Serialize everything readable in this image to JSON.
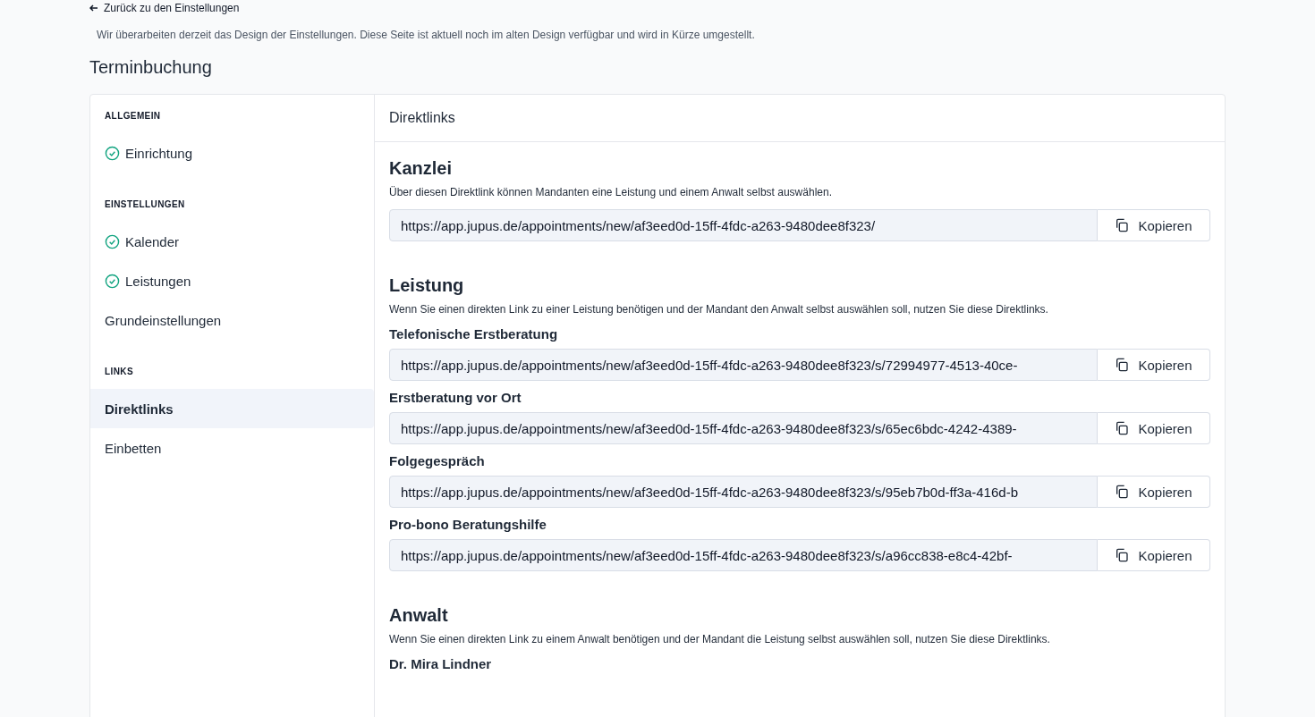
{
  "back_link": {
    "label": "Zurück zu den Einstellungen"
  },
  "notice": "Wir überarbeiten derzeit das Design der Einstellungen. Diese Seite ist aktuell noch im alten Design verfügbar und wird in Kürze umgestellt.",
  "page_title": "Terminbuchung",
  "sidebar": {
    "groups": [
      {
        "heading": "ALLGEMEIN",
        "items": [
          {
            "label": "Einrichtung",
            "done": true,
            "selected": false
          }
        ]
      },
      {
        "heading": "EINSTELLUNGEN",
        "items": [
          {
            "label": "Kalender",
            "done": true,
            "selected": false
          },
          {
            "label": "Leistungen",
            "done": true,
            "selected": false
          },
          {
            "label": "Grundeinstellungen",
            "done": false,
            "selected": false
          }
        ]
      },
      {
        "heading": "LINKS",
        "items": [
          {
            "label": "Direktlinks",
            "done": false,
            "selected": true
          },
          {
            "label": "Einbetten",
            "done": false,
            "selected": false
          }
        ]
      }
    ]
  },
  "panel": {
    "title": "Direktlinks",
    "sections": [
      {
        "title": "Kanzlei",
        "description": "Über diesen Direktlink können Mandanten eine Leistung und einem Anwalt selbst auswählen.",
        "links": [
          {
            "url": "https://app.jupus.de/appointments/new/af3eed0d-15ff-4fdc-a263-9480dee8f323/",
            "button": "Kopieren"
          }
        ]
      },
      {
        "title": "Leistung",
        "description": "Wenn Sie einen direkten Link zu einer Leistung benötigen und der Mandant den Anwalt selbst auswählen soll, nutzen Sie diese Direktlinks.",
        "links": [
          {
            "label": "Telefonische Erstberatung",
            "url": "https://app.jupus.de/appointments/new/af3eed0d-15ff-4fdc-a263-9480dee8f323/s/72994977-4513-40ce-",
            "button": "Kopieren"
          },
          {
            "label": "Erstberatung vor Ort",
            "url": "https://app.jupus.de/appointments/new/af3eed0d-15ff-4fdc-a263-9480dee8f323/s/65ec6bdc-4242-4389-",
            "button": "Kopieren"
          },
          {
            "label": "Folgegespräch",
            "url": "https://app.jupus.de/appointments/new/af3eed0d-15ff-4fdc-a263-9480dee8f323/s/95eb7b0d-ff3a-416d-b",
            "button": "Kopieren"
          },
          {
            "label": "Pro-bono Beratungshilfe",
            "url": "https://app.jupus.de/appointments/new/af3eed0d-15ff-4fdc-a263-9480dee8f323/s/a96cc838-e8c4-42bf-",
            "button": "Kopieren"
          }
        ]
      },
      {
        "title": "Anwalt",
        "description": "Wenn Sie einen direkten Link zu einem Anwalt benötigen und der Mandant die Leistung selbst auswählen soll, nutzen Sie diese Direktlinks.",
        "links": [
          {
            "label": "Dr. Mira Lindner"
          }
        ]
      }
    ]
  }
}
